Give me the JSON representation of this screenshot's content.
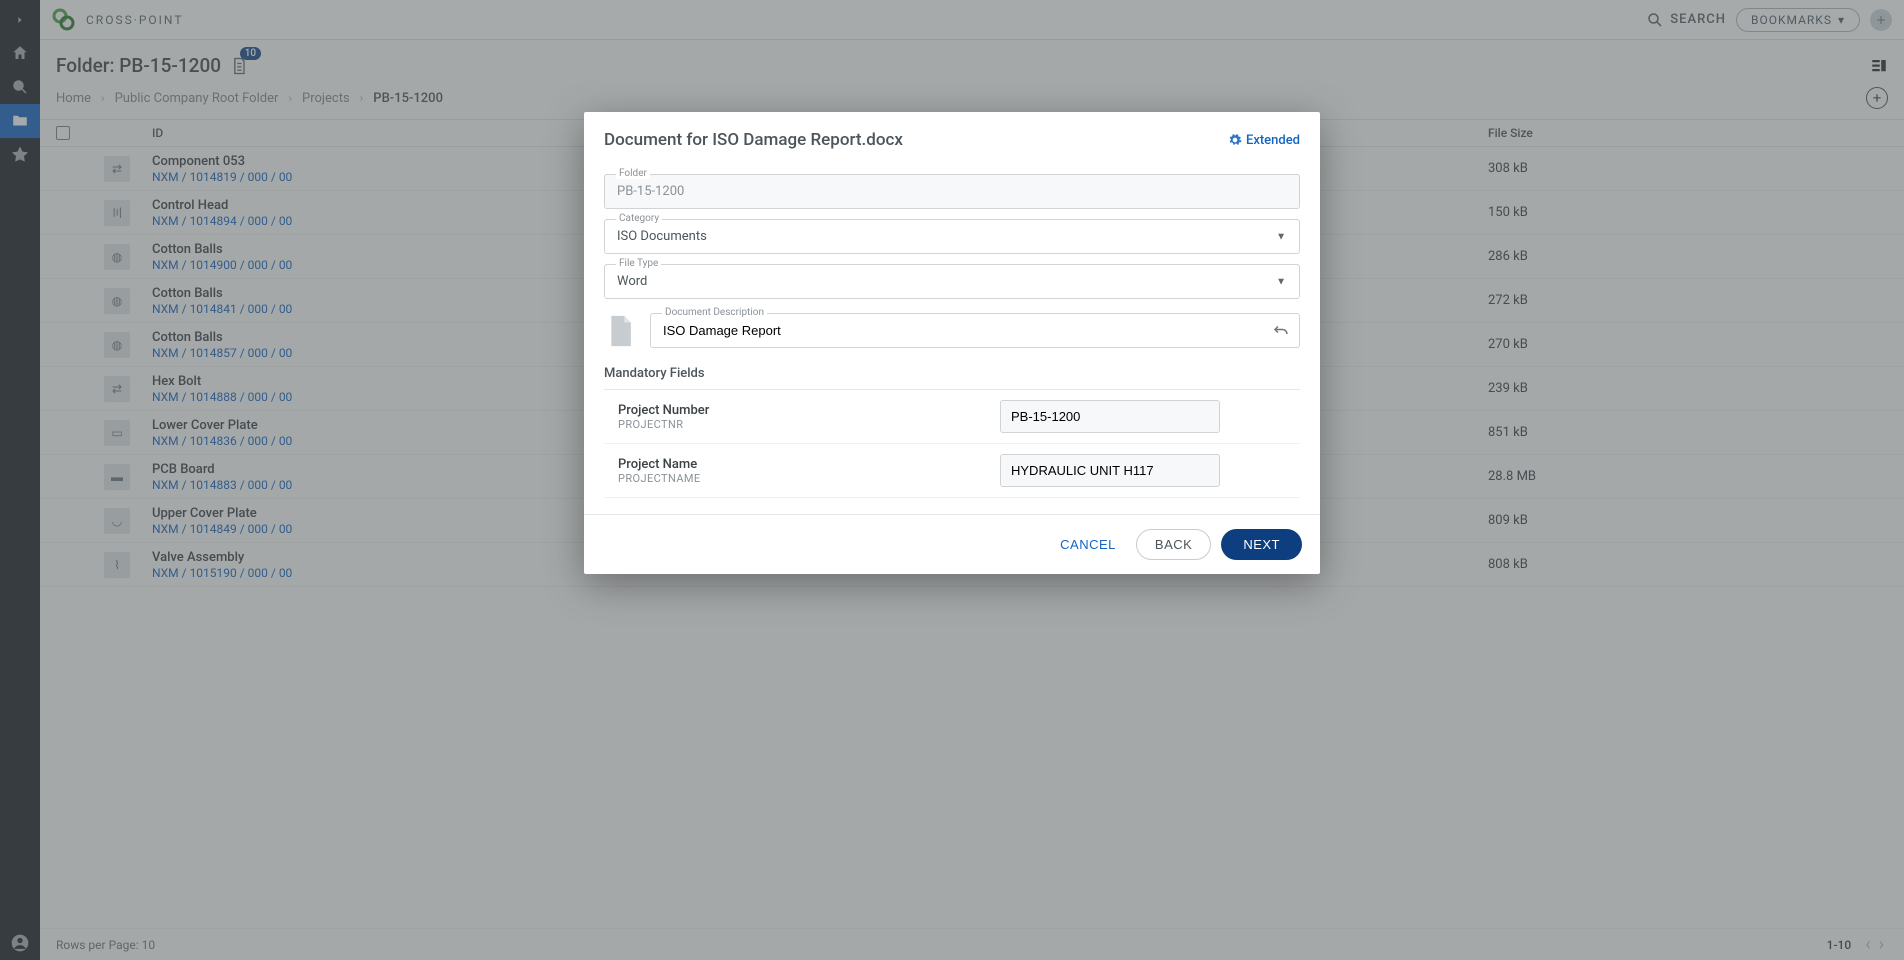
{
  "header": {
    "app_name": "CROSS·POINT",
    "search_label": "SEARCH",
    "bookmarks_label": "BOOKMARKS"
  },
  "folder": {
    "title": "Folder: PB-15-1200",
    "badge": "10"
  },
  "breadcrumbs": [
    {
      "label": "Home",
      "current": false
    },
    {
      "label": "Public Company Root Folder",
      "current": false
    },
    {
      "label": "Projects",
      "current": false
    },
    {
      "label": "PB-15-1200",
      "current": true
    }
  ],
  "table": {
    "columns": {
      "id": "ID",
      "file_size": "File Size"
    },
    "rows": [
      {
        "name": "Component 053",
        "code": "NXM / 1014819 / 000 / 00",
        "size": "308 kB",
        "thumb": "⇄"
      },
      {
        "name": "Control Head",
        "code": "NXM / 1014894 / 000 / 00",
        "size": "150 kB",
        "thumb": "〣"
      },
      {
        "name": "Cotton Balls",
        "code": "NXM / 1014900 / 000 / 00",
        "size": "286 kB",
        "thumb": "◍"
      },
      {
        "name": "Cotton Balls",
        "code": "NXM / 1014841 / 000 / 00",
        "size": "272 kB",
        "thumb": "◍"
      },
      {
        "name": "Cotton Balls",
        "code": "NXM / 1014857 / 000 / 00",
        "size": "270 kB",
        "thumb": "◍"
      },
      {
        "name": "Hex Bolt",
        "code": "NXM / 1014888 / 000 / 00",
        "size": "239 kB",
        "thumb": "⇄"
      },
      {
        "name": "Lower Cover Plate",
        "code": "NXM / 1014836 / 000 / 00",
        "size": "851 kB",
        "thumb": "▭"
      },
      {
        "name": "PCB Board",
        "code": "NXM / 1014883 / 000 / 00",
        "size": "28.8 MB",
        "thumb": "▬"
      },
      {
        "name": "Upper Cover Plate",
        "code": "NXM / 1014849 / 000 / 00",
        "size": "809 kB",
        "thumb": "◡"
      },
      {
        "name": "Valve Assembly",
        "code": "NXM / 1015190 / 000 / 00",
        "size": "808 kB",
        "thumb": "⌇"
      }
    ]
  },
  "footer": {
    "rows_label": "Rows per Page: 10",
    "range": "1-10"
  },
  "modal": {
    "title": "Document for ISO Damage Report.docx",
    "extended_label": "Extended",
    "fields": {
      "folder": {
        "label": "Folder",
        "value": "PB-15-1200"
      },
      "category": {
        "label": "Category",
        "value": "ISO Documents"
      },
      "file_type": {
        "label": "File Type",
        "value": "Word"
      },
      "description": {
        "label": "Document Description",
        "value": "ISO Damage Report"
      }
    },
    "mandatory": {
      "heading": "Mandatory Fields",
      "rows": [
        {
          "label": "Project Number",
          "sub": "PROJECTNR",
          "value": "PB-15-1200"
        },
        {
          "label": "Project Name",
          "sub": "PROJECTNAME",
          "value": "HYDRAULIC UNIT H117"
        }
      ]
    },
    "buttons": {
      "cancel": "CANCEL",
      "back": "BACK",
      "next": "NEXT"
    }
  }
}
